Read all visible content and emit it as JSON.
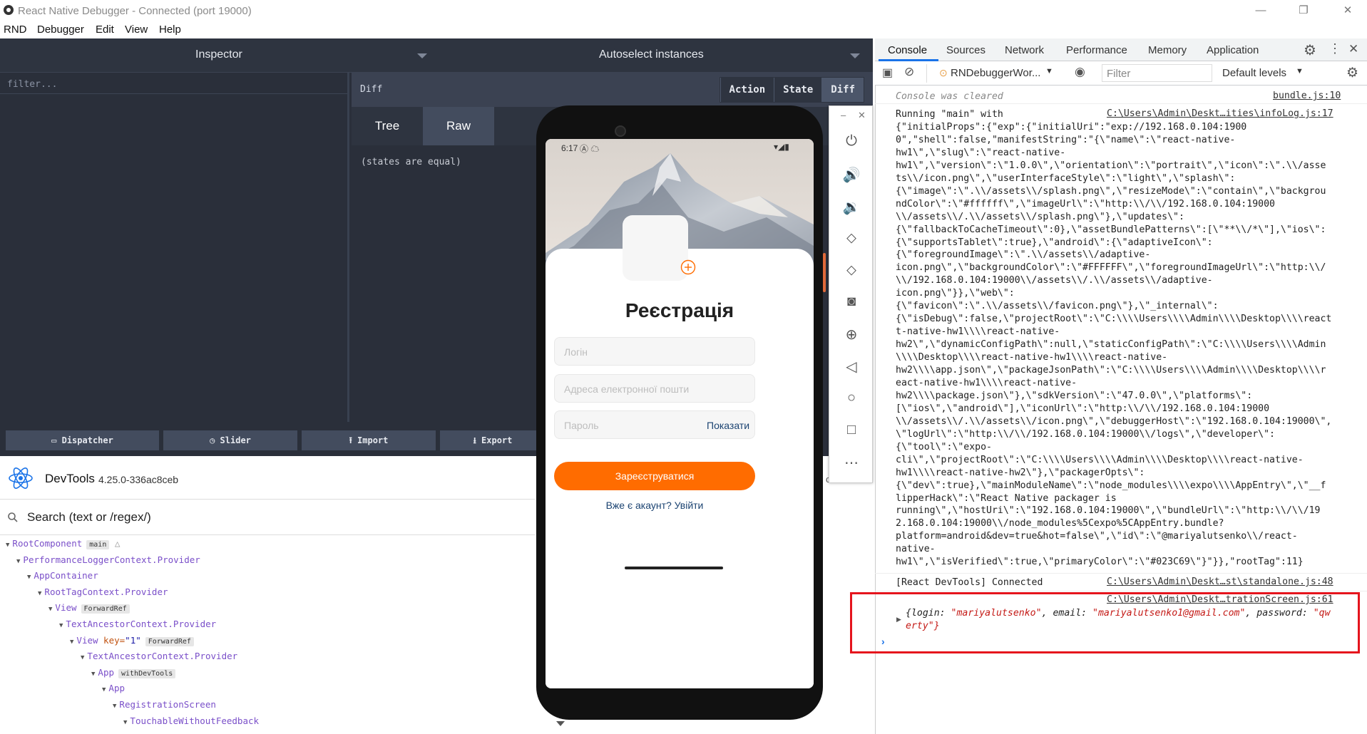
{
  "window": {
    "title": "React Native Debugger - Connected (port 19000)",
    "minimize": "—",
    "restore": "❐",
    "close": "✕"
  },
  "menu": [
    "RND",
    "Debugger",
    "Edit",
    "View",
    "Help"
  ],
  "rnd": {
    "inspector_label": "Inspector",
    "autoselect_label": "Autoselect instances",
    "filter_placeholder": "filter...",
    "diff_label": "Diff",
    "buttons": [
      "Action",
      "State",
      "Diff"
    ],
    "tabs": [
      "Tree",
      "Raw"
    ],
    "states_text": "(states are equal)",
    "bottom_buttons": [
      "Dispatcher",
      "Slider",
      "Import",
      "Export"
    ]
  },
  "rdt": {
    "title": "DevTools",
    "version": "4.25.0-336ac8ceb",
    "search_placeholder": "Search (text or /regex/)",
    "tree": [
      {
        "name": "RootComponent",
        "tag": "main",
        "warn": true
      },
      {
        "name": "PerformanceLoggerContext.Provider"
      },
      {
        "name": "AppContainer"
      },
      {
        "name": "RootTagContext.Provider"
      },
      {
        "name": "View",
        "tag": "ForwardRef"
      },
      {
        "name": "TextAncestorContext.Provider"
      },
      {
        "name": "View",
        "key": "key",
        "keyval": "\"1\"",
        "tag": "ForwardRef"
      },
      {
        "name": "TextAncestorContext.Provider"
      },
      {
        "name": "App",
        "tag": "withDevTools"
      },
      {
        "name": "App"
      },
      {
        "name": "RegistrationScreen"
      },
      {
        "name": "TouchableWithoutFeedback"
      }
    ],
    "side_label": "other"
  },
  "phone": {
    "time": "6:17",
    "title": "Реєстрація",
    "login_placeholder": "Логін",
    "email_placeholder": "Адреса електронної пошти",
    "password_placeholder": "Пароль",
    "show_label": "Показати",
    "register_label": "Зареєструватися",
    "login_link": "Вже є акаунт? Увійти",
    "accent": "#ff6c00"
  },
  "devtools": {
    "tabs": [
      "Console",
      "Sources",
      "Network",
      "Performance",
      "Memory",
      "Application"
    ],
    "context": "RNDebuggerWor...",
    "filter_placeholder": "Filter",
    "levels": "Default levels",
    "cleared": "Console was cleared",
    "cleared_src": "bundle.js:10",
    "log_src": "C:\\Users\\Admin\\Deskt…ities\\infoLog.js:17",
    "log_lines": [
      "Running \"main\" with",
      "{\"initialProps\":{\"exp\":{\"initialUri\":\"exp://192.168.0.104:1900",
      "0\",\"shell\":false,\"manifestString\":\"{\\\"name\\\":\\\"react-native-",
      "hw1\\\",\\\"slug\\\":\\\"react-native-",
      "hw1\\\",\\\"version\\\":\\\"1.0.0\\\",\\\"orientation\\\":\\\"portrait\\\",\\\"icon\\\":\\\".\\\\/asse",
      "ts\\\\/icon.png\\\",\\\"userInterfaceStyle\\\":\\\"light\\\",\\\"splash\\\":",
      "{\\\"image\\\":\\\".\\\\/assets\\\\/splash.png\\\",\\\"resizeMode\\\":\\\"contain\\\",\\\"backgrou",
      "ndColor\\\":\\\"#ffffff\\\",\\\"imageUrl\\\":\\\"http:\\\\/\\\\/192.168.0.104:19000",
      "\\\\/assets\\\\/.\\\\/assets\\\\/splash.png\\\"},\\\"updates\\\":",
      "{\\\"fallbackToCacheTimeout\\\":0},\\\"assetBundlePatterns\\\":[\\\"**\\\\/*\\\"],\\\"ios\\\":",
      "{\\\"supportsTablet\\\":true},\\\"android\\\":{\\\"adaptiveIcon\\\":",
      "{\\\"foregroundImage\\\":\\\".\\\\/assets\\\\/adaptive-",
      "icon.png\\\",\\\"backgroundColor\\\":\\\"#FFFFFF\\\",\\\"foregroundImageUrl\\\":\\\"http:\\\\/",
      "\\\\/192.168.0.104:19000\\\\/assets\\\\/.\\\\/assets\\\\/adaptive-",
      "icon.png\\\"}},\\\"web\\\":",
      "{\\\"favicon\\\":\\\".\\\\/assets\\\\/favicon.png\\\"},\\\"_internal\\\":",
      "{\\\"isDebug\\\":false,\\\"projectRoot\\\":\\\"C:\\\\\\\\Users\\\\\\\\Admin\\\\\\\\Desktop\\\\\\\\react",
      "t-native-hw1\\\\\\\\react-native-",
      "hw2\\\",\\\"dynamicConfigPath\\\":null,\\\"staticConfigPath\\\":\\\"C:\\\\\\\\Users\\\\\\\\Admin",
      "\\\\\\\\Desktop\\\\\\\\react-native-hw1\\\\\\\\react-native-",
      "hw2\\\\\\\\app.json\\\",\\\"packageJsonPath\\\":\\\"C:\\\\\\\\Users\\\\\\\\Admin\\\\\\\\Desktop\\\\\\\\r",
      "eact-native-hw1\\\\\\\\react-native-",
      "hw2\\\\\\\\package.json\\\"},\\\"sdkVersion\\\":\\\"47.0.0\\\",\\\"platforms\\\":",
      "[\\\"ios\\\",\\\"android\\\"],\\\"iconUrl\\\":\\\"http:\\\\/\\\\/192.168.0.104:19000",
      "\\\\/assets\\\\/.\\\\/assets\\\\/icon.png\\\",\\\"debuggerHost\\\":\\\"192.168.0.104:19000\\\",",
      "\\\"logUrl\\\":\\\"http:\\\\/\\\\/192.168.0.104:19000\\\\/logs\\\",\\\"developer\\\":",
      "{\\\"tool\\\":\\\"expo-",
      "cli\\\",\\\"projectRoot\\\":\\\"C:\\\\\\\\Users\\\\\\\\Admin\\\\\\\\Desktop\\\\\\\\react-native-",
      "hw1\\\\\\\\react-native-hw2\\\"},\\\"packagerOpts\\\":",
      "{\\\"dev\\\":true},\\\"mainModuleName\\\":\\\"node_modules\\\\\\\\expo\\\\\\\\AppEntry\\\",\\\"__f",
      "lipperHack\\\":\\\"React Native packager is",
      "running\\\",\\\"hostUri\\\":\\\"192.168.0.104:19000\\\",\\\"bundleUrl\\\":\\\"http:\\\\/\\\\/19",
      "2.168.0.104:19000\\\\/node_modules%5Cexpo%5CAppEntry.bundle?",
      "platform=android&dev=true&hot=false\\\",\\\"id\\\":\\\"@mariyalutsenko\\\\/react-",
      "native-",
      "hw1\\\",\\\"isVerified\\\":true,\\\"primaryColor\\\":\\\"#023C69\\\"}\"}},\"rootTag\":11}"
    ],
    "connected": "[React DevTools] Connected",
    "connected_src": "C:\\Users\\Admin\\Deskt…st\\standalone.js:48",
    "reg_src": "C:\\Users\\Admin\\Deskt…trationScreen.js:61",
    "obj_line1": "{login: \"mariyalutsenko\", email: \"mariyalutsenko1@gmail.com\", password: \"qw",
    "obj_line2": "erty\"}"
  }
}
